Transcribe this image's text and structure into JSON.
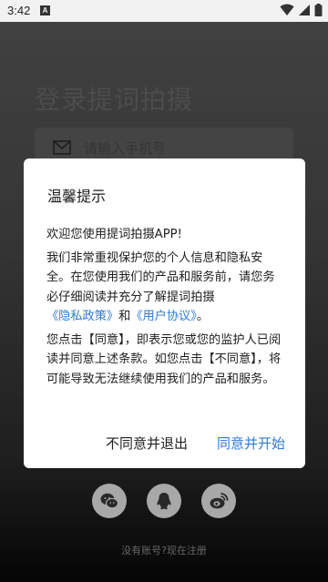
{
  "status_bar": {
    "time": "3:42",
    "a_icon_label": "A"
  },
  "login": {
    "title": "登录提词拍摄",
    "phone_placeholder": "请输入手机号",
    "register_link": "没有账号?现在注册"
  },
  "social": [
    {
      "icon": "wechat-icon"
    },
    {
      "icon": "qq-icon"
    },
    {
      "icon": "weibo-icon"
    }
  ],
  "dialog": {
    "title": "温馨提示",
    "welcome": "欢迎您使用提词拍摄APP!",
    "para1_a": "我们非常重视保护您的个人信息和隐私安全。在您使用我们的产品和服务前，请您务必仔细阅读并充分了解提词拍摄",
    "privacy_link": "《隐私政策》",
    "para1_and": "和",
    "agreement_link": "《用户协议》",
    "para1_end": "。",
    "para2": "您点击【同意】，即表示您或您的监护人已阅读并同意上述条款。如您点击【不同意】，将可能导致无法继续使用我们的产品和服务。",
    "disagree_button": "不同意并退出",
    "agree_button": "同意并开始"
  },
  "colors": {
    "accent": "#2f7ad6",
    "dialog_bg": "#ffffff"
  }
}
